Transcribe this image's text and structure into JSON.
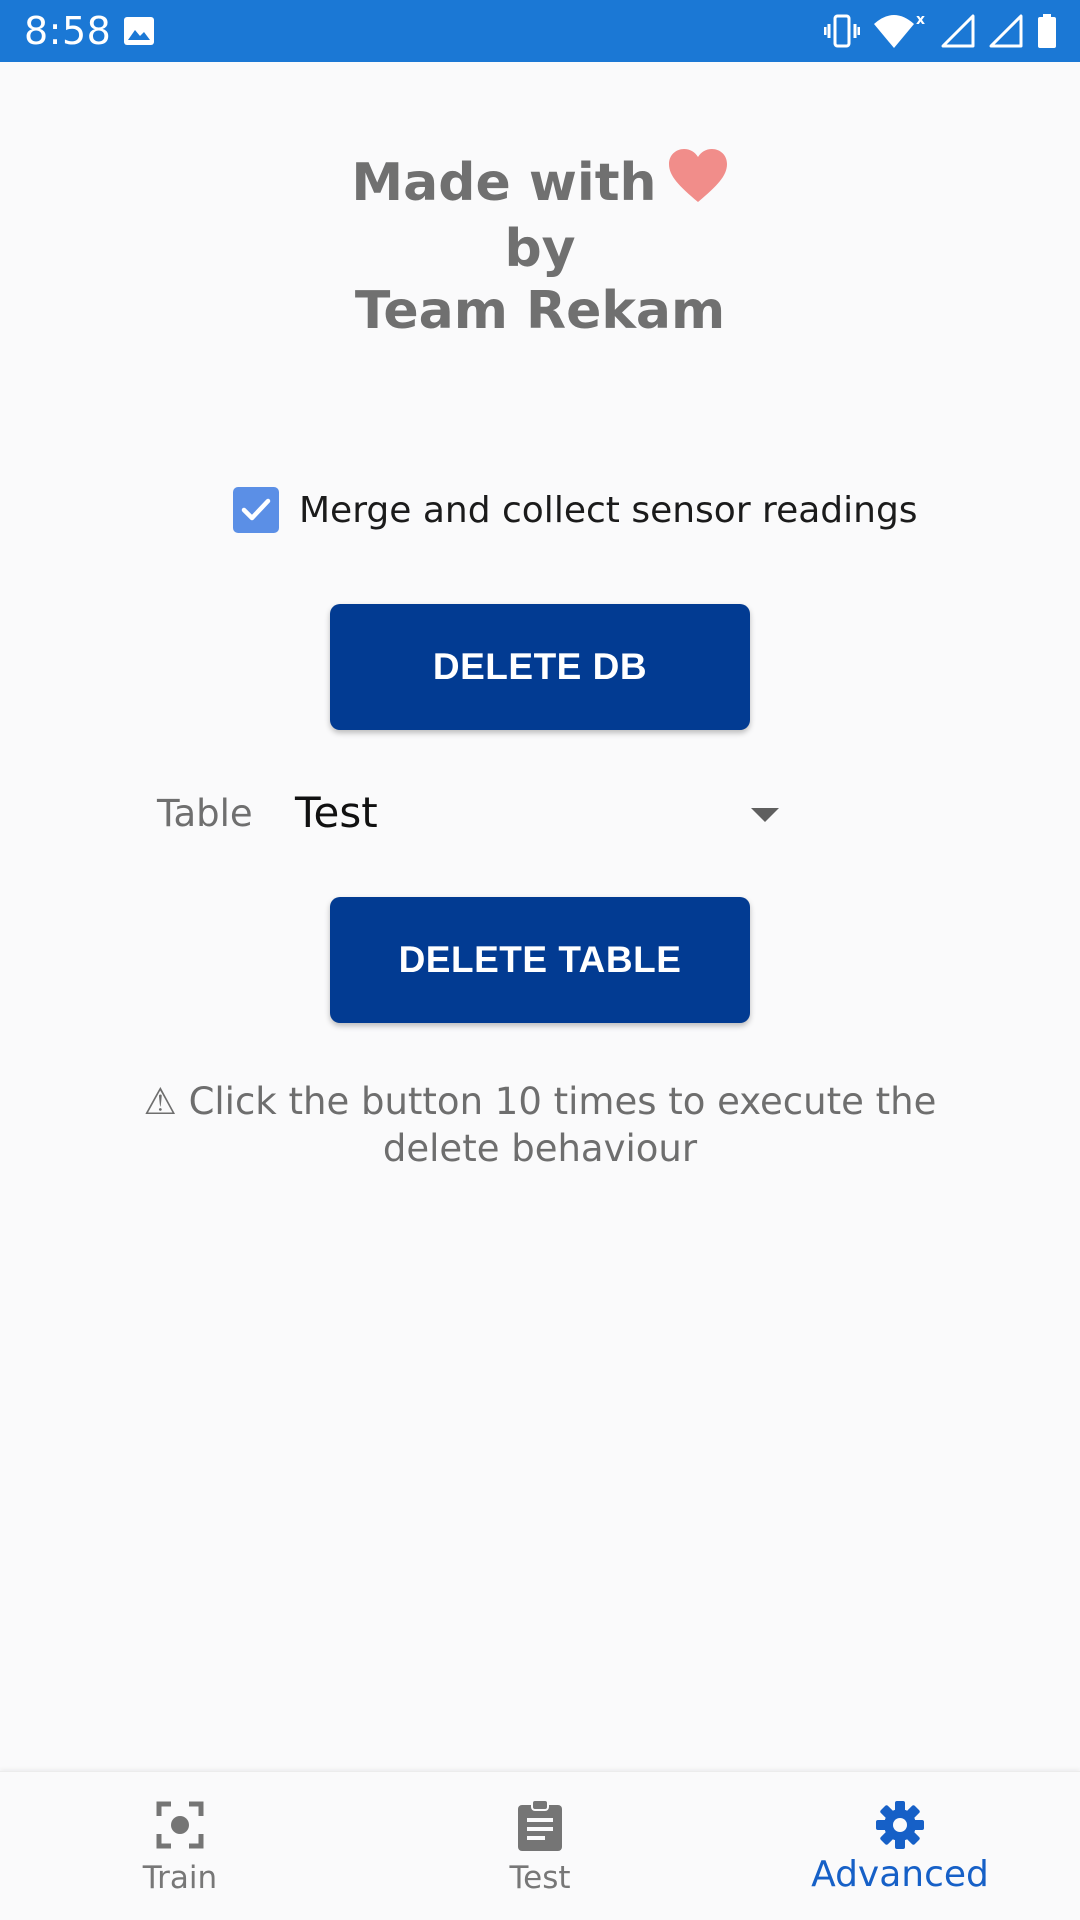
{
  "status_bar": {
    "time": "8:58",
    "icons": [
      "gallery-icon",
      "vibrate-icon",
      "wifi-icon",
      "signal-icon",
      "signal-icon",
      "battery-icon"
    ]
  },
  "credits": {
    "line1": "Made with",
    "line2": "by",
    "line3": "Team Rekam",
    "heart_icon": "heart-icon"
  },
  "settings": {
    "merge_checkbox_label": "Merge and collect sensor readings",
    "merge_checked": true,
    "delete_db_label": "DELETE DB",
    "table_label": "Table",
    "table_selected": "Test",
    "delete_table_label": "DELETE TABLE",
    "warning_text": "⚠ Click the button 10 times to execute the delete behaviour"
  },
  "bottom_nav": {
    "items": [
      {
        "label": "Train",
        "icon": "center-focus-icon",
        "active": false
      },
      {
        "label": "Test",
        "icon": "clipboard-icon",
        "active": false
      },
      {
        "label": "Advanced",
        "icon": "gear-icon",
        "active": true
      }
    ]
  },
  "colors": {
    "status_bar": "#1b78d5",
    "primary_button": "#023b92",
    "checkbox": "#5b8fe6",
    "active_nav": "#1660c7",
    "heart": "#f18d8a"
  }
}
